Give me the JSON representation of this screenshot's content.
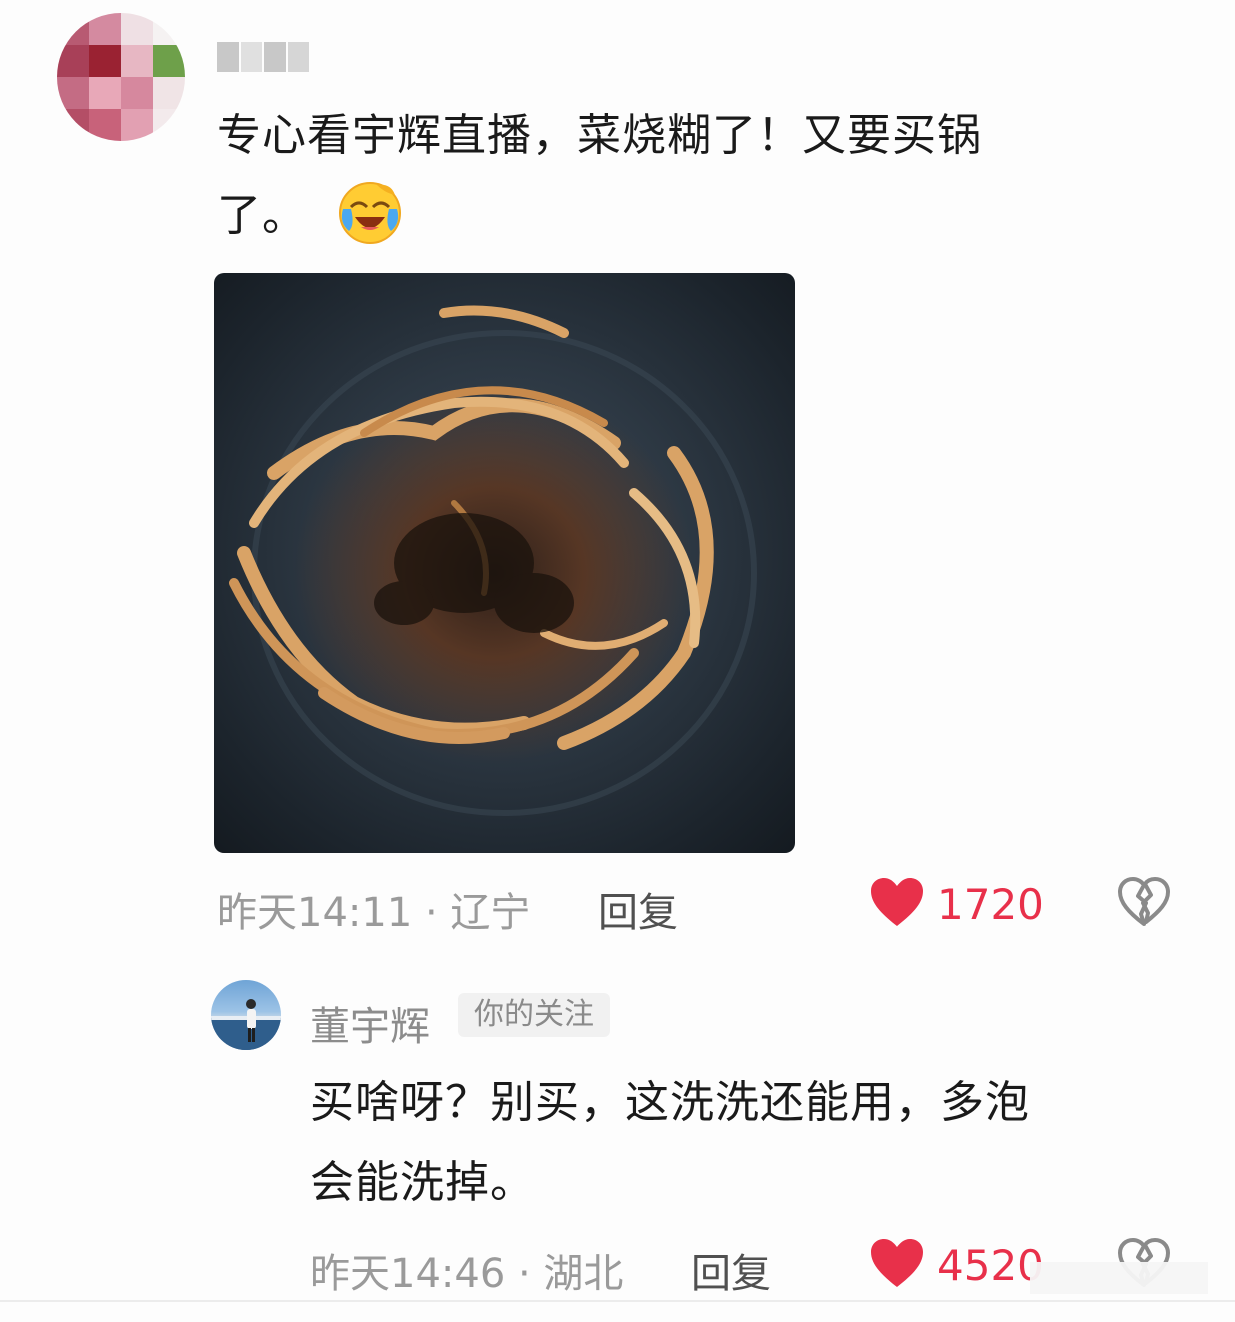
{
  "comment": {
    "text_line1": "专心看宇辉直播，菜烧糊了！又要买锅",
    "text_line2": "了。",
    "emoji": "laughing-crying-emoji",
    "time_location": "昨天14:11 · 辽宁",
    "reply_label": "回复",
    "like_count": "1720"
  },
  "reply": {
    "author": "董宇辉",
    "badge": "你的关注",
    "text_line1": "买啥呀？别买，这洗洗还能用，多泡",
    "text_line2": "会能洗掉。",
    "time_location": "昨天14:46 · 湖北",
    "reply_label": "回复",
    "like_count": "4520"
  },
  "colors": {
    "accent_like": "#e8304a",
    "meta_text": "#9a9a9a",
    "badge_bg": "#f1f1f1"
  }
}
